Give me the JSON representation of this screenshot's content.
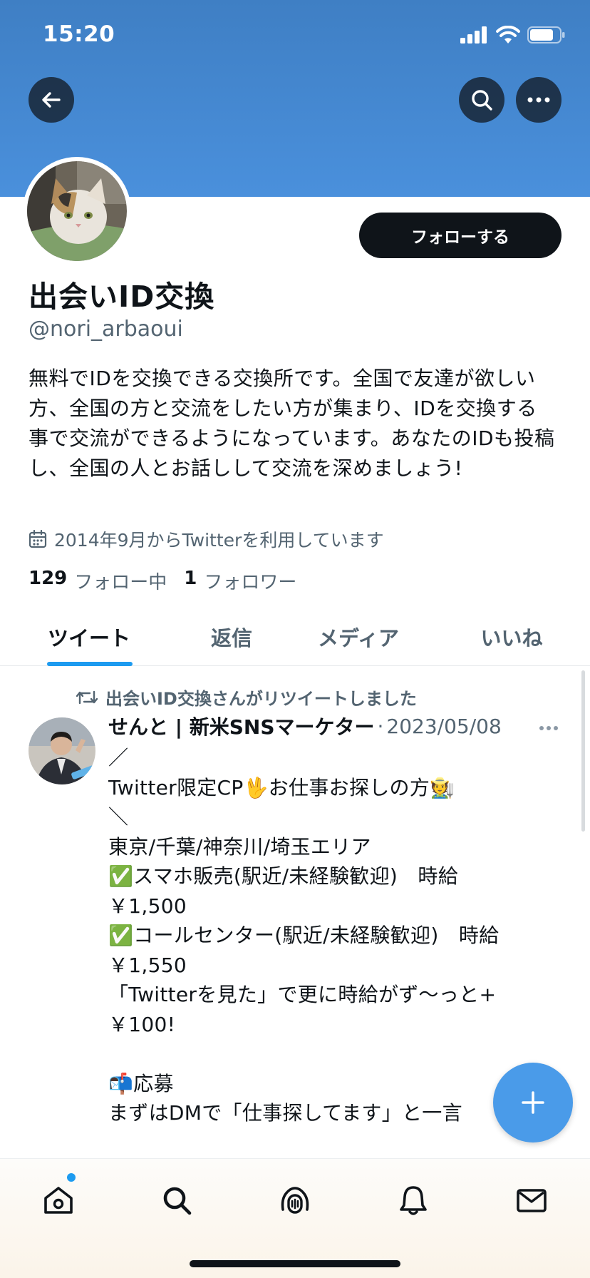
{
  "status_bar": {
    "time": "15:20"
  },
  "profile": {
    "follow_label": "フォローする",
    "name": "出会いID交換",
    "handle": "@nori_arbaoui",
    "bio": "無料でIDを交換できる交換所です。全国で友達が欲しい方、全国の方と交流をしたい方が集まり、IDを交換する事で交流ができるようになっています。あなたのIDも投稿し、全国の人とお話しして交流を深めましょう!",
    "joined": "2014年9月からTwitterを利用しています",
    "following_count": "129",
    "following_label": "フォロー中",
    "followers_count": "1",
    "followers_label": "フォロワー"
  },
  "tabs": [
    {
      "label": "ツイート",
      "active": true
    },
    {
      "label": "返信",
      "active": false
    },
    {
      "label": "メディア",
      "active": false
    },
    {
      "label": "いいね",
      "active": false
    }
  ],
  "tweet": {
    "retweet_text": "出会いID交換さんがリツイートしました",
    "author": "せんと | 新米SNSマーケター",
    "date": "2023/05/08",
    "body": "／\nTwitter限定CP🖖お仕事お探しの方🧑‍🌾\n＼\n東京/千葉/神奈川/埼玉エリア\n✅スマホ販売(駅近/未経験歓迎)　時給\n￥1,500\n✅コールセンター(駅近/未経験歓迎)　時給\n￥1,550\n「Twitterを見た」で更に時給がず〜っと+\n￥100!\n\n📬応募\nまずはDMで「仕事探してます」と一言"
  },
  "icons": {
    "back": "arrow-left-icon",
    "search": "search-icon",
    "more": "more-icon",
    "calendar": "calendar-icon",
    "retweet": "retweet-icon",
    "compose": "plus-icon",
    "nav": [
      "home-icon",
      "search-icon",
      "spaces-icon",
      "bell-icon",
      "mail-icon"
    ]
  },
  "colors": {
    "accent": "#1d9bf0",
    "banner": "#4a90dc",
    "fab": "#4a9be9"
  }
}
